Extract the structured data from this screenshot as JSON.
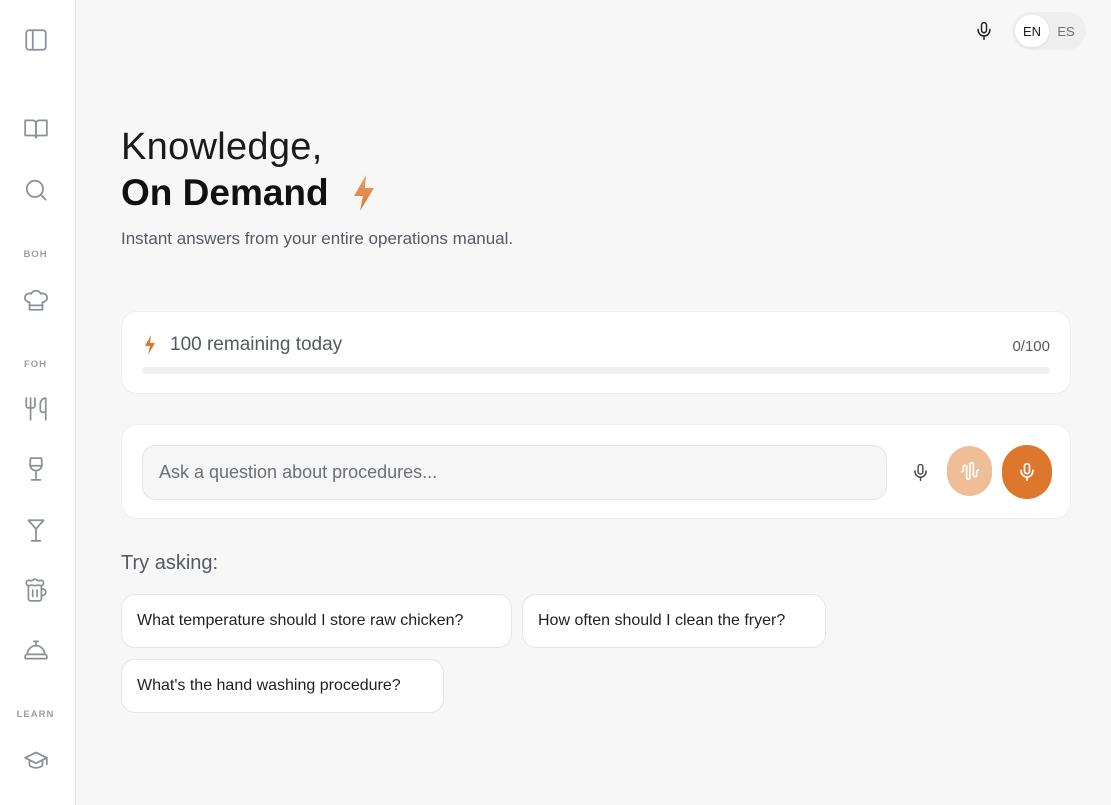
{
  "sidebar": {
    "icons": [
      "sidebar-toggle-icon",
      "book-icon",
      "search-icon",
      "chef-hat-icon",
      "utensils-icon",
      "wine-glass-icon",
      "martini-icon",
      "beer-mug-icon",
      "service-bell-icon",
      "graduation-cap-icon"
    ],
    "sections": {
      "boh": "BOH",
      "foh": "FOH",
      "learn": "LEARN"
    }
  },
  "header": {
    "languages": [
      "EN",
      "ES"
    ],
    "selected_language": "EN"
  },
  "hero": {
    "line1": "Knowledge,",
    "line2": "On Demand",
    "subtitle": "Instant answers from your entire operations manual."
  },
  "usage": {
    "label": "100 remaining today",
    "count": "0/100",
    "progress_fraction": 0
  },
  "ask": {
    "placeholder": "Ask a question about procedures...",
    "value": ""
  },
  "suggestions": {
    "label": "Try asking:",
    "items": [
      "What temperature should I store raw chicken?",
      "How often should I clean the fryer?",
      "What's the hand washing procedure?"
    ]
  },
  "colors": {
    "accent": "#dd772d",
    "accent_light": "#efbe97",
    "background": "#f7f7f7"
  }
}
